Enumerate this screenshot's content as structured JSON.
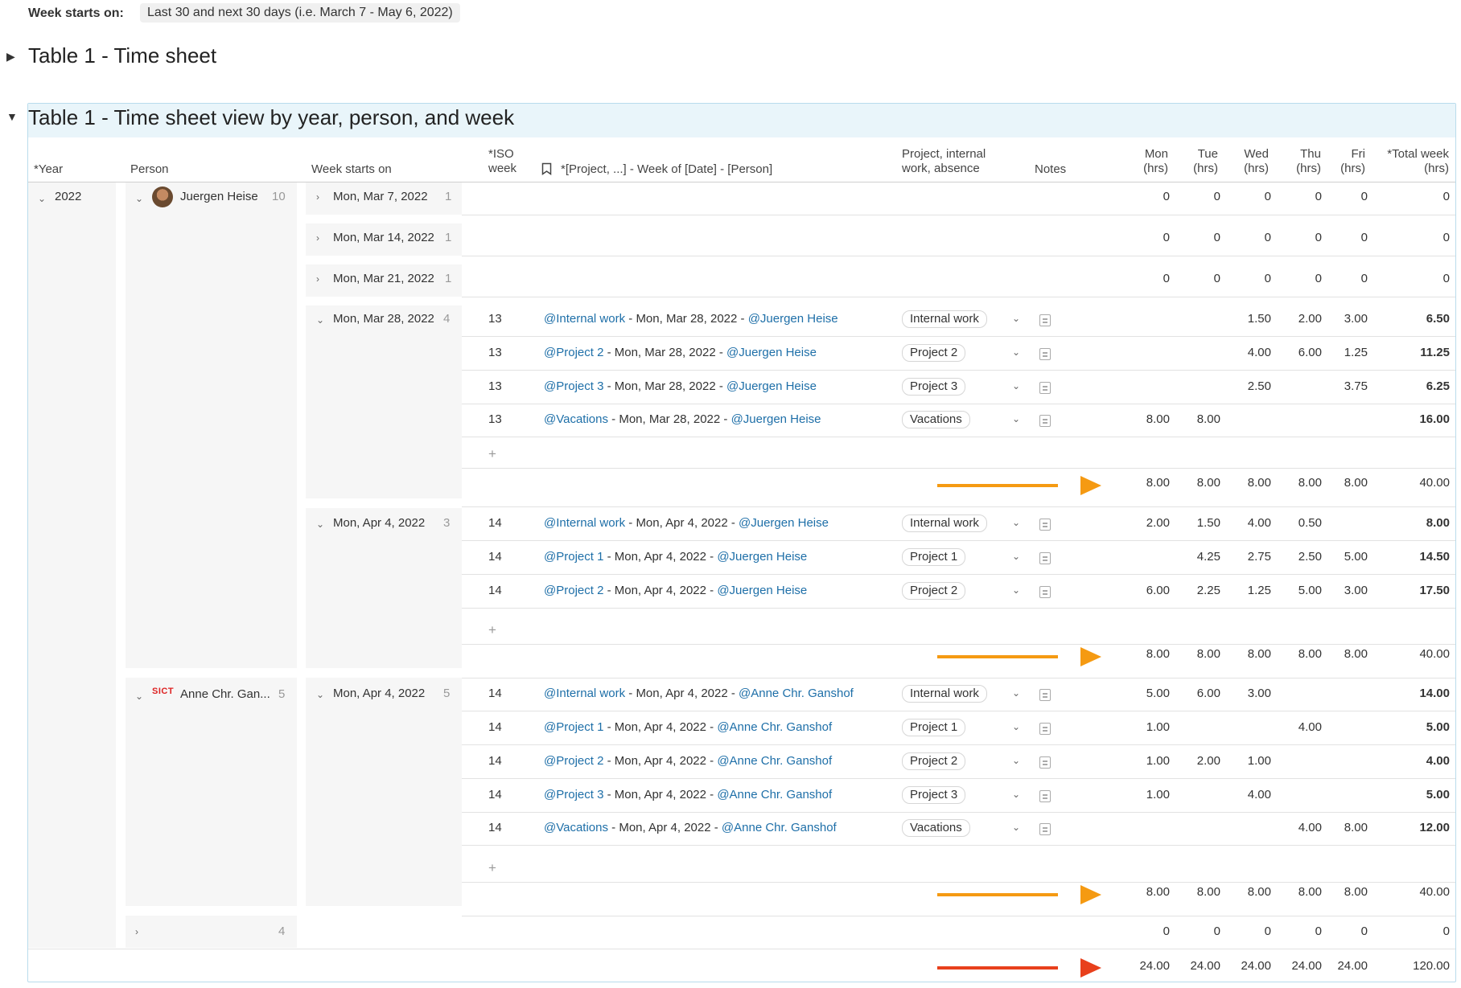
{
  "filter": {
    "label": "Week starts on:",
    "value": "Last 30 and next 30 days (i.e. March 7 - May 6, 2022)"
  },
  "sections": {
    "collapsed_title": "Table 1 - Time sheet",
    "expanded_title": "Table 1 - Time sheet view by year, person, and week"
  },
  "columns": {
    "year": "*Year",
    "person": "Person",
    "week_starts": "Week starts on",
    "iso_l1": "*ISO",
    "iso_l2": "week",
    "name": "*[Project, ...] - Week of [Date] - [Person]",
    "proj_l1": "Project, internal",
    "proj_l2": "work, absence",
    "notes": "Notes",
    "mon_l1": "Mon",
    "tue_l1": "Tue",
    "wed_l1": "Wed",
    "thu_l1": "Thu",
    "fri_l1": "Fri",
    "hrs": "(hrs)",
    "total_l1": "*Total week",
    "total_l2": "(hrs)"
  },
  "groups": {
    "year": "2022",
    "person1": {
      "name": "Juergen Heise",
      "count": "10"
    },
    "person2": {
      "name": "Anne Chr. Gan...",
      "count": "5",
      "logo": "SICT"
    },
    "person3": {
      "count": "4"
    },
    "weeks": [
      {
        "label": "Mon, Mar 7, 2022",
        "count": "1"
      },
      {
        "label": "Mon, Mar 14, 2022",
        "count": "1"
      },
      {
        "label": "Mon, Mar 21, 2022",
        "count": "1"
      },
      {
        "label": "Mon, Mar 28, 2022",
        "count": "4"
      },
      {
        "label": "Mon, Apr 4, 2022",
        "count": "3"
      },
      {
        "label": "Mon, Apr 4, 2022",
        "count": "5"
      }
    ]
  },
  "empty_week_totals": [
    "0",
    "0",
    "0",
    "0",
    "0",
    "0"
  ],
  "rows": [
    {
      "iso": "13",
      "proj": "@Internal work",
      "date": " - Mon, Mar 28, 2022 - ",
      "person": "@Juergen Heise",
      "pill": "Internal work",
      "mon": "",
      "tue": "",
      "wed": "1.50",
      "thu": "2.00",
      "fri": "3.00",
      "total": "6.50"
    },
    {
      "iso": "13",
      "proj": "@Project 2",
      "date": " - Mon, Mar 28, 2022 - ",
      "person": "@Juergen Heise",
      "pill": "Project 2",
      "mon": "",
      "tue": "",
      "wed": "4.00",
      "thu": "6.00",
      "fri": "1.25",
      "total": "11.25"
    },
    {
      "iso": "13",
      "proj": "@Project 3",
      "date": " - Mon, Mar 28, 2022 - ",
      "person": "@Juergen Heise",
      "pill": "Project 3",
      "mon": "",
      "tue": "",
      "wed": "2.50",
      "thu": "",
      "fri": "3.75",
      "total": "6.25"
    },
    {
      "iso": "13",
      "proj": "@Vacations",
      "date": " - Mon, Mar 28, 2022 - ",
      "person": "@Juergen Heise",
      "pill": "Vacations",
      "mon": "8.00",
      "tue": "8.00",
      "wed": "",
      "thu": "",
      "fri": "",
      "total": "16.00"
    },
    {
      "iso": "14",
      "proj": "@Internal work",
      "date": " - Mon, Apr 4, 2022 - ",
      "person": "@Juergen Heise",
      "pill": "Internal work",
      "mon": "2.00",
      "tue": "1.50",
      "wed": "4.00",
      "thu": "0.50",
      "fri": "",
      "total": "8.00"
    },
    {
      "iso": "14",
      "proj": "@Project 1",
      "date": " - Mon, Apr 4, 2022 - ",
      "person": "@Juergen Heise",
      "pill": "Project 1",
      "mon": "",
      "tue": "4.25",
      "wed": "2.75",
      "thu": "2.50",
      "fri": "5.00",
      "total": "14.50"
    },
    {
      "iso": "14",
      "proj": "@Project 2",
      "date": " - Mon, Apr 4, 2022 - ",
      "person": "@Juergen Heise",
      "pill": "Project 2",
      "mon": "6.00",
      "tue": "2.25",
      "wed": "1.25",
      "thu": "5.00",
      "fri": "3.00",
      "total": "17.50"
    },
    {
      "iso": "14",
      "proj": "@Internal work",
      "date": " - Mon, Apr 4, 2022 - ",
      "person": "@Anne Chr. Ganshof",
      "pill": "Internal work",
      "mon": "5.00",
      "tue": "6.00",
      "wed": "3.00",
      "thu": "",
      "fri": "",
      "total": "14.00"
    },
    {
      "iso": "14",
      "proj": "@Project 1",
      "date": " - Mon, Apr 4, 2022 - ",
      "person": "@Anne Chr. Ganshof",
      "pill": "Project 1",
      "mon": "1.00",
      "tue": "",
      "wed": "",
      "thu": "4.00",
      "fri": "",
      "total": "5.00"
    },
    {
      "iso": "14",
      "proj": "@Project 2",
      "date": " - Mon, Apr 4, 2022 - ",
      "person": "@Anne Chr. Ganshof",
      "pill": "Project 2",
      "mon": "1.00",
      "tue": "2.00",
      "wed": "1.00",
      "thu": "",
      "fri": "",
      "total": "4.00"
    },
    {
      "iso": "14",
      "proj": "@Project 3",
      "date": " - Mon, Apr 4, 2022 - ",
      "person": "@Anne Chr. Ganshof",
      "pill": "Project 3",
      "mon": "1.00",
      "tue": "",
      "wed": "4.00",
      "thu": "",
      "fri": "",
      "total": "5.00"
    },
    {
      "iso": "14",
      "proj": "@Vacations",
      "date": " - Mon, Apr 4, 2022 - ",
      "person": "@Anne Chr. Ganshof",
      "pill": "Vacations",
      "mon": "",
      "tue": "",
      "wed": "",
      "thu": "4.00",
      "fri": "8.00",
      "total": "12.00"
    }
  ],
  "subtotals": {
    "week_total": {
      "mon": "8.00",
      "tue": "8.00",
      "wed": "8.00",
      "thu": "8.00",
      "fri": "8.00",
      "total": "40.00"
    },
    "grand_total": {
      "mon": "24.00",
      "tue": "24.00",
      "wed": "24.00",
      "thu": "24.00",
      "fri": "24.00",
      "total": "120.00"
    }
  },
  "add_row": "+",
  "colors": {
    "accent_arrow": "#f59a12",
    "grand_arrow": "#e8401c",
    "link": "#1e6fa8",
    "header_bg": "#e9f5fa"
  }
}
